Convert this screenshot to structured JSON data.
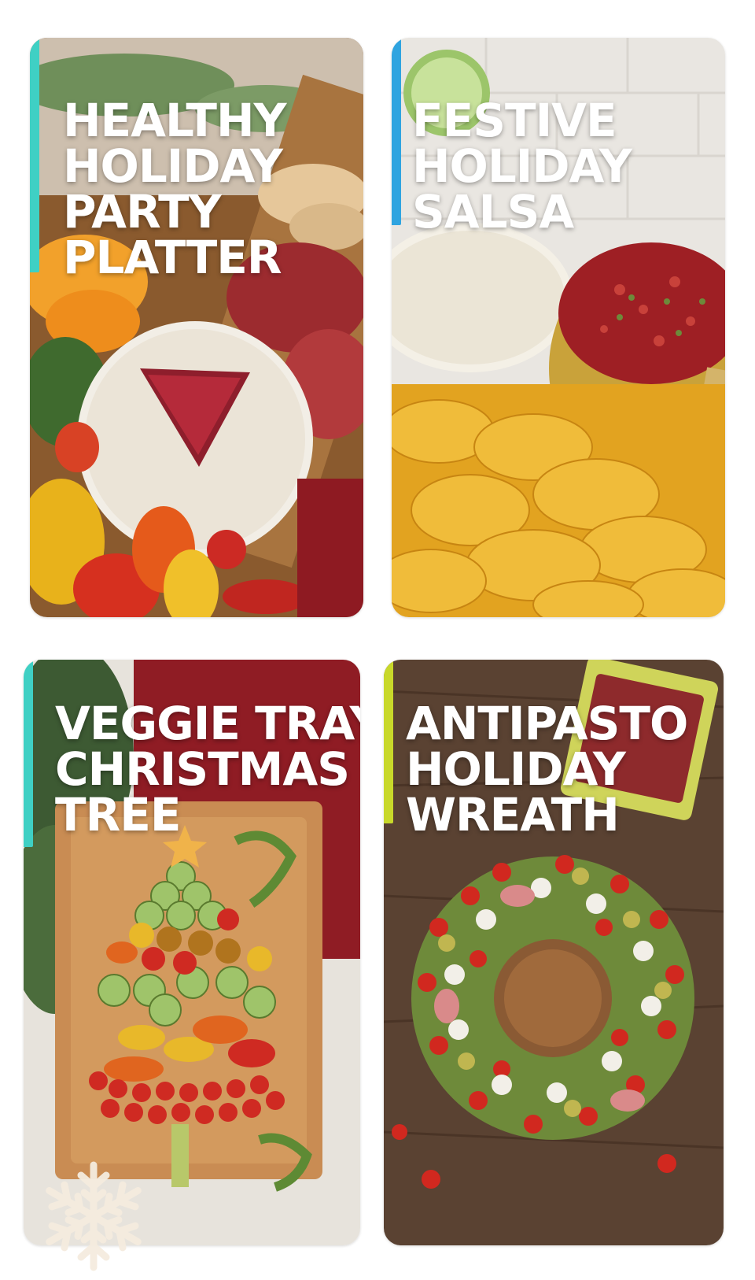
{
  "cards": [
    {
      "lines": [
        "HEALTHY",
        "HOLIDAY",
        "PARTY",
        "PLATTER"
      ],
      "accent": "#3fd0c4",
      "photo": "charcuterie board with brie cheese, pomegranate tree, salami, oranges, peppers"
    },
    {
      "lines": [
        "FESTIVE",
        "HOLIDAY",
        "SALSA"
      ],
      "accent": "#2fa4e0",
      "photo": "cranberry salsa in gold bowl with tortilla chips"
    },
    {
      "lines": [
        "VEGGIE TRAY",
        "CHRISTMAS",
        "TREE"
      ],
      "accent": "#3fd0c4",
      "photo": "vegetable tray arranged as a christmas tree on a wooden board"
    },
    {
      "lines": [
        "ANTIPASTO",
        "HOLIDAY",
        "WREATH"
      ],
      "accent": "#c8d82a",
      "photo": "antipasto skewers arranged in a wreath with tomatoes, mozzarella and rosemary"
    }
  ],
  "decor": {
    "snowflake_icon": "snowflake-icon"
  },
  "colors": {
    "background": "#ffffff",
    "title": "#ffffff"
  }
}
